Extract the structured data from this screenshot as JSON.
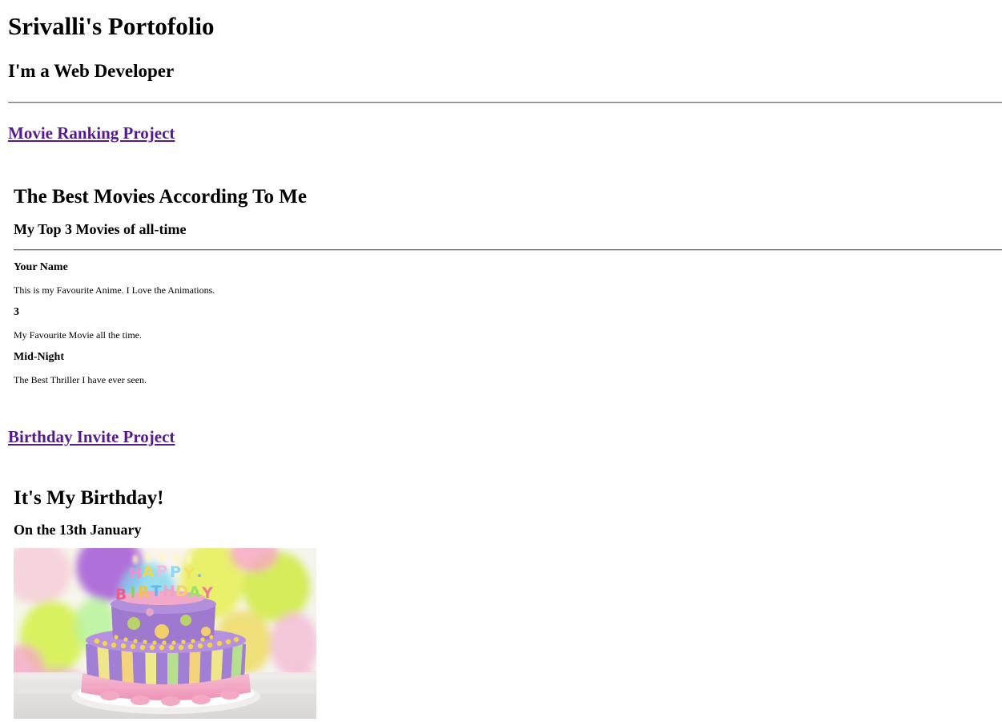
{
  "header": {
    "title": "Srivalli's Portofolio",
    "subtitle": "I'm a Web Developer"
  },
  "projects": [
    {
      "link_label": "Movie Ranking Project",
      "heading": "The Best Movies According To Me",
      "subheading": "My Top 3 Movies of all-time",
      "movies": [
        {
          "title": "Your Name",
          "description": "This is my Favourite Anime. I Love the Animations."
        },
        {
          "title": "3",
          "description": "My Favourite Movie all the time."
        },
        {
          "title": "Mid-Night",
          "description": "The Best Thriller I have ever seen."
        }
      ]
    },
    {
      "link_label": "Birthday Invite Project",
      "heading": "It's My Birthday!",
      "subheading": "On the 13th January",
      "image": {
        "icon": "birthday-cake-image",
        "candle_letters": "HAPPY BIRTHDAY"
      }
    }
  ],
  "colors": {
    "link": "#551a8b",
    "text": "#000000",
    "background": "#ffffff"
  }
}
